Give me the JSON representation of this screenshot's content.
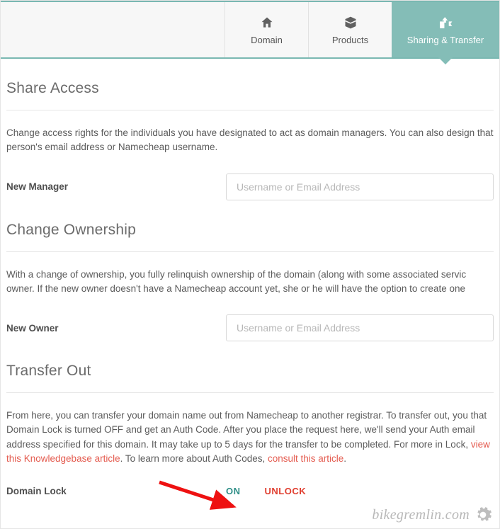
{
  "tabs": {
    "domain": "Domain",
    "products": "Products",
    "sharing": "Sharing & Transfer"
  },
  "share_access": {
    "heading": "Share Access",
    "desc": "Change access rights for the individuals you have designated to act as domain managers. You can also design that person's email address or Namecheap username.",
    "field_label": "New Manager",
    "placeholder": "Username or Email Address"
  },
  "change_ownership": {
    "heading": "Change Ownership",
    "desc": "With a change of ownership, you fully relinquish ownership of the domain (along with some associated servic owner. If the new owner doesn't have a Namecheap account yet, she or he will have the option to create one",
    "field_label": "New Owner",
    "placeholder": "Username or Email Address"
  },
  "transfer_out": {
    "heading": "Transfer Out",
    "desc_part1": "From here, you can transfer your domain name out from Namecheap to another registrar. To transfer out, you that Domain Lock is turned OFF and get an Auth Code. After you place the request here, we'll send your Auth email address specified for this domain. It may take up to 5 days for the transfer to be completed. For more in Lock, ",
    "link1": "view this Knowledgebase article",
    "desc_part2": ". To learn more about Auth Codes, ",
    "link2": "consult this article",
    "desc_part3": ".",
    "lock_label": "Domain Lock",
    "lock_status": "ON",
    "unlock": "UNLOCK"
  },
  "watermark": "bikegremlin.com"
}
